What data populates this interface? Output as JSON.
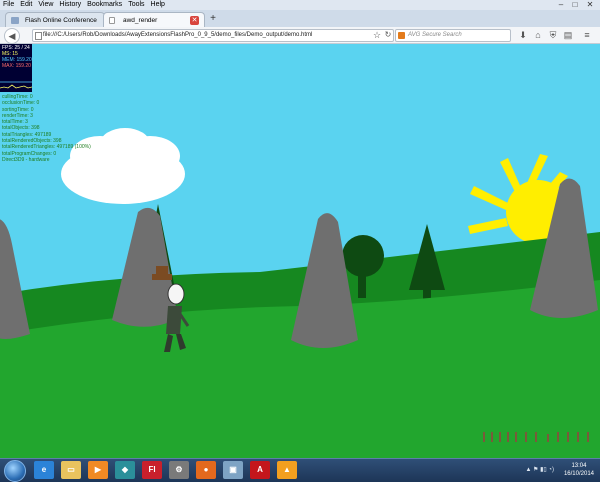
{
  "menubar": {
    "items": [
      "File",
      "Edit",
      "View",
      "History",
      "Bookmarks",
      "Tools",
      "Help"
    ]
  },
  "window_controls": {
    "minimize": "–",
    "maximize": "□",
    "close": "✕"
  },
  "tabs": [
    {
      "label": "Flash Online Conference",
      "active": false
    },
    {
      "label": "awd_render",
      "active": true
    }
  ],
  "new_tab": "+",
  "navbar": {
    "back": "◀",
    "url": "file:///C:/Users/Rob/Downloads/AwayExtensionsFlashPro_0_9_5/demo_files/Demo_output/demo.html",
    "reload": "↻",
    "search_placeholder": "AVG Secure Search",
    "icons": {
      "bookmark_star": "☆",
      "download": "⬇",
      "home": "⌂",
      "menu": "≡",
      "shield": "⛨",
      "clipboard": "▤"
    }
  },
  "stats": {
    "fps": "FPS: 25 / 24",
    "ms": "MS: 15",
    "mem": "MEM: 159.20",
    "max": "MAX: 159.20"
  },
  "debug_lines": [
    "cullingTime: 0",
    "occlusionTime: 0",
    "sortingTime: 0",
    "renderTime: 3",
    "totalTime: 3",
    "totalObjects: 398",
    "totalTriangles: 497189",
    "totalRenderedObjects: 398",
    "totalRenderedTriangles: 497189 (100%)",
    "totalProgramChanges: 0",
    "Direct3D9 - hardware"
  ],
  "scene": {
    "colors": {
      "sky": "#5ad3f0",
      "grass": "#22a62e",
      "hill_back": "#168820",
      "sun": "#ffee00",
      "rock": "#6f6f6f"
    }
  },
  "taskbar": {
    "apps": [
      {
        "name": "ie",
        "glyph": "e",
        "color": "#2b83d8"
      },
      {
        "name": "explorer",
        "glyph": "▭",
        "color": "#e9c35e"
      },
      {
        "name": "media",
        "glyph": "▶",
        "color": "#f08a24"
      },
      {
        "name": "dreamweaver",
        "glyph": "◆",
        "color": "#2b8f9a"
      },
      {
        "name": "flash",
        "glyph": "Fl",
        "color": "#c9202c"
      },
      {
        "name": "network",
        "glyph": "⚙",
        "color": "#7a7a7a"
      },
      {
        "name": "firefox",
        "glyph": "●",
        "color": "#e3691d"
      },
      {
        "name": "monitor",
        "glyph": "▣",
        "color": "#7ea3c4"
      },
      {
        "name": "acrobat",
        "glyph": "A",
        "color": "#c4161c"
      },
      {
        "name": "vlc",
        "glyph": "▲",
        "color": "#f39f1f"
      }
    ],
    "time": "13:04",
    "date": "16/10/2014"
  }
}
